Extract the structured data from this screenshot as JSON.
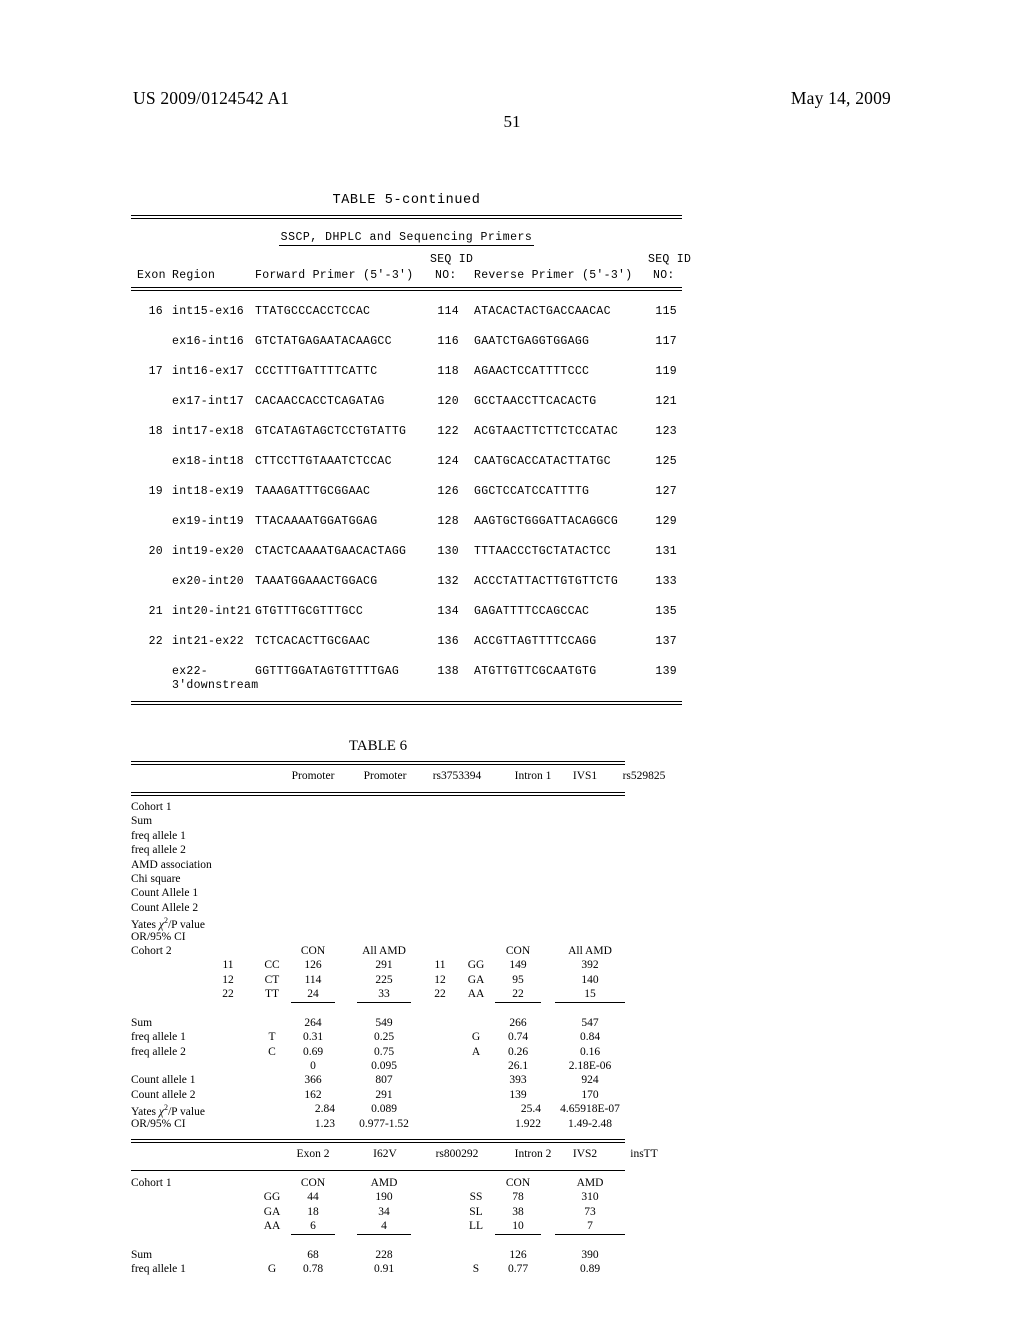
{
  "header": {
    "publication_number": "US 2009/0124542 A1",
    "publication_date": "May 14, 2009",
    "page_number": "51"
  },
  "table5": {
    "caption": "TABLE 5-continued",
    "subtitle": "SSCP, DHPLC and Sequencing Primers",
    "headers": {
      "exon": "Exon",
      "region": "Region",
      "forward": "Forward Primer (5'-3')",
      "seq_id_1_line1": "SEQ ID",
      "seq_id_1_line2": "NO:",
      "reverse": "Reverse Primer (5'-3')",
      "seq_id_2_line1": "SEQ ID",
      "seq_id_2_line2": "NO:"
    },
    "rows": [
      {
        "exon": "16",
        "region": "int15-ex16",
        "forward": "TTATGCCCACCTCCAC",
        "seq1": "114",
        "reverse": "ATACACTACTGACCAACAC",
        "seq2": "115"
      },
      {
        "exon": "",
        "region": "ex16-int16",
        "forward": "GTCTATGAGAATACAAGCC",
        "seq1": "116",
        "reverse": "GAATCTGAGGTGGAGG",
        "seq2": "117"
      },
      {
        "exon": "17",
        "region": "int16-ex17",
        "forward": "CCCTTTGATTTTCATTC",
        "seq1": "118",
        "reverse": "AGAACTCCATTTTCCC",
        "seq2": "119"
      },
      {
        "exon": "",
        "region": "ex17-int17",
        "forward": "CACAACCACCTCAGATAG",
        "seq1": "120",
        "reverse": "GCCTAACCTTCACACTG",
        "seq2": "121"
      },
      {
        "exon": "18",
        "region": "int17-ex18",
        "forward": "GTCATAGTAGCTCCTGTATTG",
        "seq1": "122",
        "reverse": "ACGTAACTTCTTCTCCATAC",
        "seq2": "123"
      },
      {
        "exon": "",
        "region": "ex18-int18",
        "forward": "CTTCCTTGTAAATCTCCAC",
        "seq1": "124",
        "reverse": "CAATGCACCATACTTATGC",
        "seq2": "125"
      },
      {
        "exon": "19",
        "region": "int18-ex19",
        "forward": "TAAAGATTTGCGGAAC",
        "seq1": "126",
        "reverse": "GGCTCCATCCATTTTG",
        "seq2": "127"
      },
      {
        "exon": "",
        "region": "ex19-int19",
        "forward": "TTACAAAATGGATGGAG",
        "seq1": "128",
        "reverse": "AAGTGCTGGGATTACAGGCG",
        "seq2": "129"
      },
      {
        "exon": "20",
        "region": "int19-ex20",
        "forward": "CTACTCAAAATGAACACTAGG",
        "seq1": "130",
        "reverse": "TTTAACCCTGCTATACTCC",
        "seq2": "131"
      },
      {
        "exon": "",
        "region": "ex20-int20",
        "forward": "TAAATGGAAACTGGACG",
        "seq1": "132",
        "reverse": "ACCCTATTACTTGTGTTCTG",
        "seq2": "133"
      },
      {
        "exon": "21",
        "region": "int20-int21",
        "forward": "GTGTTTGCGTTTGCC",
        "seq1": "134",
        "reverse": "GAGATTTTCCAGCCAC",
        "seq2": "135"
      },
      {
        "exon": "22",
        "region": "int21-ex22",
        "forward": "TCTCACACTTGCGAAC",
        "seq1": "136",
        "reverse": "ACCGTTAGTTTTCCAGG",
        "seq2": "137"
      },
      {
        "exon": "",
        "region": "ex22-\n3'downstream",
        "forward": "GGTTTGGATAGTGTTTTGAG",
        "seq1": "138",
        "reverse": "ATGTTGTTCGCAATGTG",
        "seq2": "139"
      }
    ]
  },
  "table6": {
    "caption": "TABLE 6",
    "section1": {
      "headers": [
        "Promoter",
        "Promoter",
        "rs3753394",
        "Intron 1",
        "IVS1",
        "rs529825"
      ],
      "cohort1_label": "Cohort 1",
      "cohort1_rows": [
        "Sum",
        "freq allele 1",
        "freq allele 2",
        "AMD association",
        "Chi square",
        "Count Allele 1",
        "Count Allele 2",
        "Yates χ²/P value",
        "OR/95% CI"
      ],
      "cohort2_label": "Cohort 2",
      "col_headers": {
        "con": "CON",
        "amd": "All AMD",
        "con2": "CON",
        "amd2": "All AMD"
      },
      "genotype_rows": [
        {
          "code": "11",
          "gt": "CC",
          "con": "126",
          "amd": "291",
          "code2": "11",
          "gt2": "GG",
          "con2": "149",
          "amd2": "392"
        },
        {
          "code": "12",
          "gt": "CT",
          "con": "114",
          "amd": "225",
          "code2": "12",
          "gt2": "GA",
          "con2": "95",
          "amd2": "140"
        },
        {
          "code": "22",
          "gt": "TT",
          "con": "24",
          "amd": "33",
          "code2": "22",
          "gt2": "AA",
          "con2": "22",
          "amd2": "15"
        }
      ],
      "sum": {
        "label": "Sum",
        "con": "264",
        "amd": "549",
        "con2": "266",
        "amd2": "547"
      },
      "freq1": {
        "label": "freq allele 1",
        "allele": "T",
        "con": "0.31",
        "amd": "0.25",
        "allele2": "G",
        "con2": "0.74",
        "amd2": "0.84"
      },
      "freq2": {
        "label": "freq allele 2",
        "allele": "C",
        "con": "0.69",
        "amd": "0.75",
        "allele2": "A",
        "con2": "0.26",
        "amd2": "0.16"
      },
      "chi_row": {
        "label": "",
        "con": "0",
        "amd": "0.095",
        "con2": "26.1",
        "amd2": "2.18E-06"
      },
      "count1": {
        "label": "Count allele 1",
        "con": "366",
        "amd": "807",
        "con2": "393",
        "amd2": "924"
      },
      "count2": {
        "label": "Count allele 2",
        "con": "162",
        "amd": "291",
        "con2": "139",
        "amd2": "170"
      },
      "yates": {
        "label": "Yates χ²/P value",
        "con": "2.84",
        "amd": "0.089",
        "con2": "25.4",
        "amd2": "4.65918E-07"
      },
      "or_ci": {
        "label": "OR/95% CI",
        "con": "1.23",
        "amd": "0.977-1.52",
        "con2": "1.922",
        "amd2": "1.49-2.48"
      }
    },
    "section2": {
      "headers": [
        "Exon 2",
        "I62V",
        "rs800292",
        "Intron 2",
        "IVS2",
        "insTT"
      ],
      "cohort1_label": "Cohort 1",
      "col_headers": {
        "con": "CON",
        "amd": "AMD",
        "con2": "CON",
        "amd2": "AMD"
      },
      "genotype_rows": [
        {
          "gt": "GG",
          "con": "44",
          "amd": "190",
          "gt2": "SS",
          "con2": "78",
          "amd2": "310"
        },
        {
          "gt": "GA",
          "con": "18",
          "amd": "34",
          "gt2": "SL",
          "con2": "38",
          "amd2": "73"
        },
        {
          "gt": "AA",
          "con": "6",
          "amd": "4",
          "gt2": "LL",
          "con2": "10",
          "amd2": "7"
        }
      ],
      "sum": {
        "label": "Sum",
        "con": "68",
        "amd": "228",
        "con2": "126",
        "amd2": "390"
      },
      "freq1": {
        "label": "freq allele 1",
        "allele": "G",
        "con": "0.78",
        "amd": "0.91",
        "allele2": "S",
        "con2": "0.77",
        "amd2": "0.89"
      }
    }
  }
}
